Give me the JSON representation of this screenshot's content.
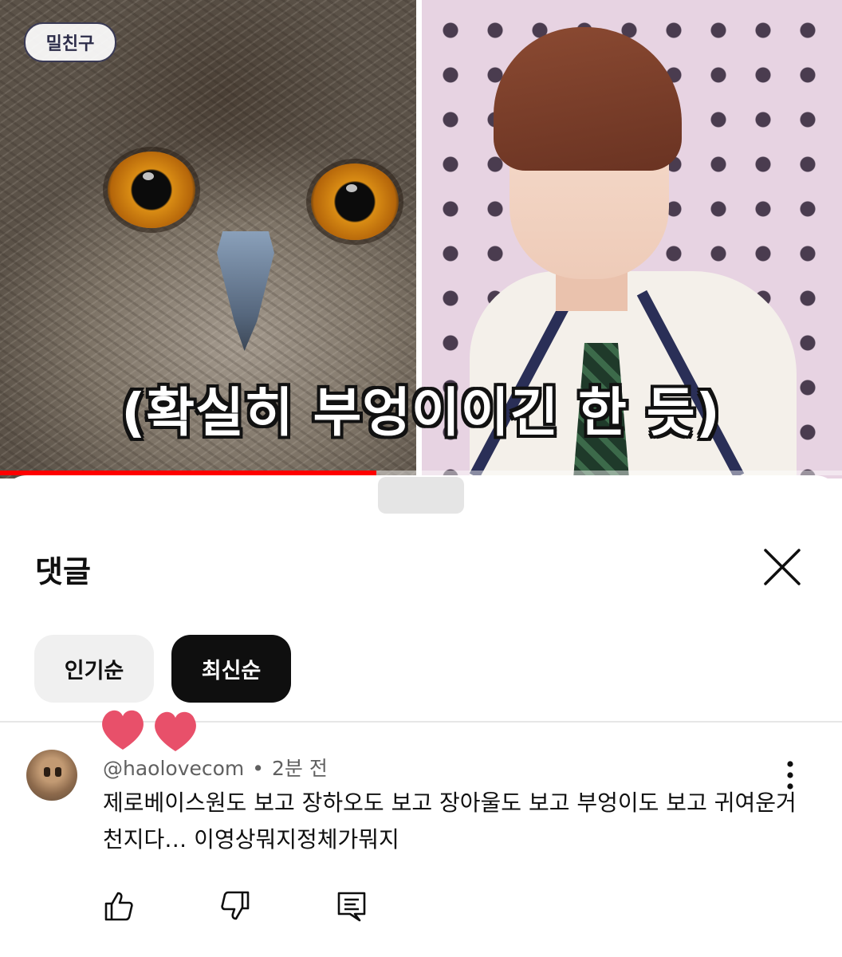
{
  "video": {
    "show_logo": "밀친구",
    "subtitle": "(확실히 부엉이이긴 한 듯)",
    "progress": 0.447,
    "progress_color": "#ff0000"
  },
  "comments_panel": {
    "title": "댓글",
    "close_icon": "close-icon",
    "sort_chips": [
      {
        "label": "인기순",
        "selected": false
      },
      {
        "label": "최신순",
        "selected": true
      }
    ]
  },
  "comment": {
    "author": "@haolovecom",
    "separator": "•",
    "time": "2분 전",
    "text": "제로베이스원도 보고 장하오도 보고 장아울도 보고 부엉이도 보고 귀여운거 천지다… 이영상뭐지정체가뭐지",
    "icons": [
      "thumbs-up-icon",
      "thumbs-down-icon",
      "reply-icon",
      "more-vert-icon"
    ]
  },
  "decorations": {
    "hearts": "heart-icon",
    "heart_color": "#e8506a"
  }
}
